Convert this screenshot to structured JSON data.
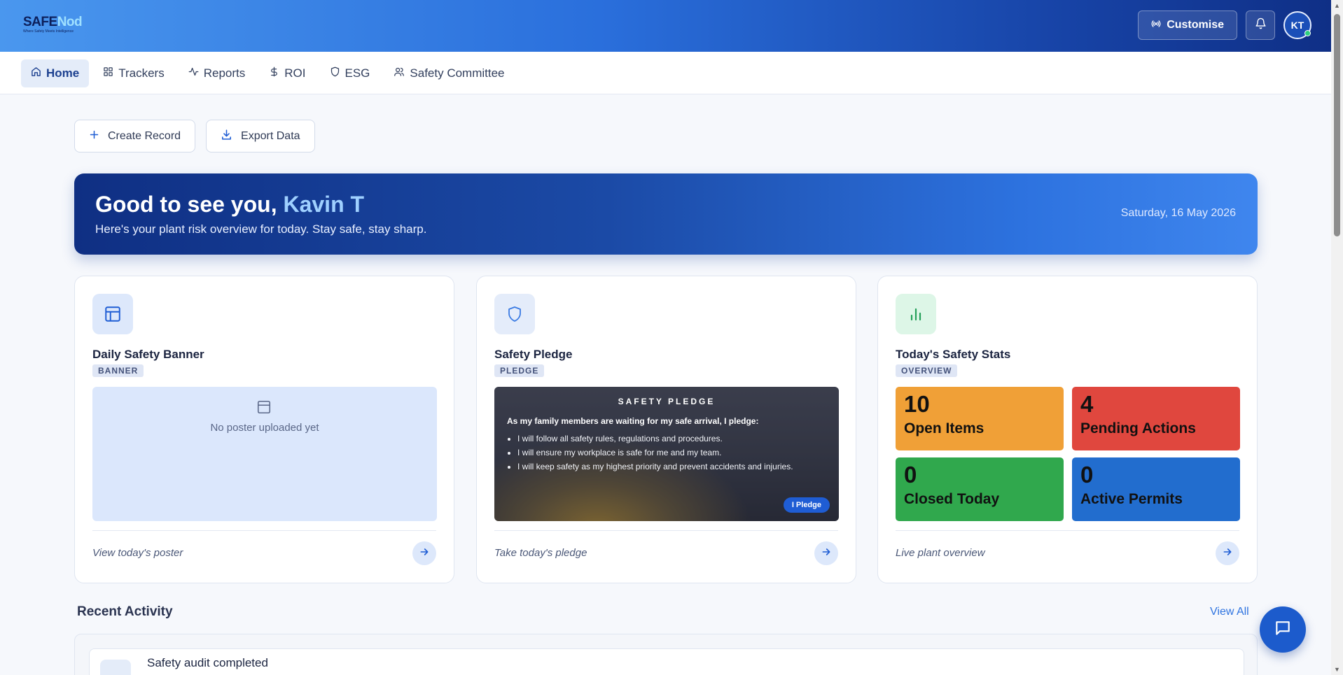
{
  "app": {
    "logo_main": "SAFE",
    "logo_accent": "Nod",
    "tagline": "Where Safety Meets Intelligence"
  },
  "topbar": {
    "customise_label": "Customise",
    "avatar_initials": "KT"
  },
  "nav": {
    "items": [
      {
        "label": "Home",
        "icon": "home-icon",
        "active": true
      },
      {
        "label": "Trackers",
        "icon": "grid-icon"
      },
      {
        "label": "Reports",
        "icon": "activity-icon"
      },
      {
        "label": "ROI",
        "icon": "dollar-icon"
      },
      {
        "label": "ESG",
        "icon": "shield-icon"
      },
      {
        "label": "Safety Committee",
        "icon": "users-icon"
      }
    ]
  },
  "actions": {
    "create_label": "Create Record",
    "export_label": "Export Data"
  },
  "welcome": {
    "greeting": "Good to see you, ",
    "name": "Kavin T",
    "subtitle": "Here's your plant risk overview for today. Stay safe, stay sharp.",
    "date": "Saturday, 16 May 2026"
  },
  "cards": {
    "banner": {
      "title": "Daily Safety Banner",
      "tag": "BANNER",
      "empty_message": "No poster uploaded yet",
      "footer": "View today's poster"
    },
    "pledge": {
      "title": "Safety Pledge",
      "tag": "PLEDGE",
      "heading": "SAFETY PLEDGE",
      "intro": "As my family members are waiting for my safe arrival, I pledge:",
      "points": [
        "I will follow all safety rules, regulations and procedures.",
        "I will ensure my workplace is safe for me and my team.",
        "I will keep safety as my highest priority and prevent accidents and injuries."
      ],
      "button": "I Pledge",
      "footer": "Take today's pledge"
    },
    "stats": {
      "title": "Today's Safety Stats",
      "tag": "OVERVIEW",
      "items": [
        {
          "value": "10",
          "label": "Open Items",
          "color": "#f0a037"
        },
        {
          "value": "4",
          "label": "Pending Actions",
          "color": "#e0473e"
        },
        {
          "value": "0",
          "label": "Closed Today",
          "color": "#30a84d"
        },
        {
          "value": "0",
          "label": "Active Permits",
          "color": "#226dce"
        }
      ],
      "footer": "Live plant overview"
    }
  },
  "recent": {
    "title": "Recent Activity",
    "view_all": "View All",
    "items": [
      {
        "title": "Safety audit completed"
      }
    ]
  },
  "colors": {
    "accent": "#2f74e0",
    "header_dark": "#0f2f86"
  }
}
